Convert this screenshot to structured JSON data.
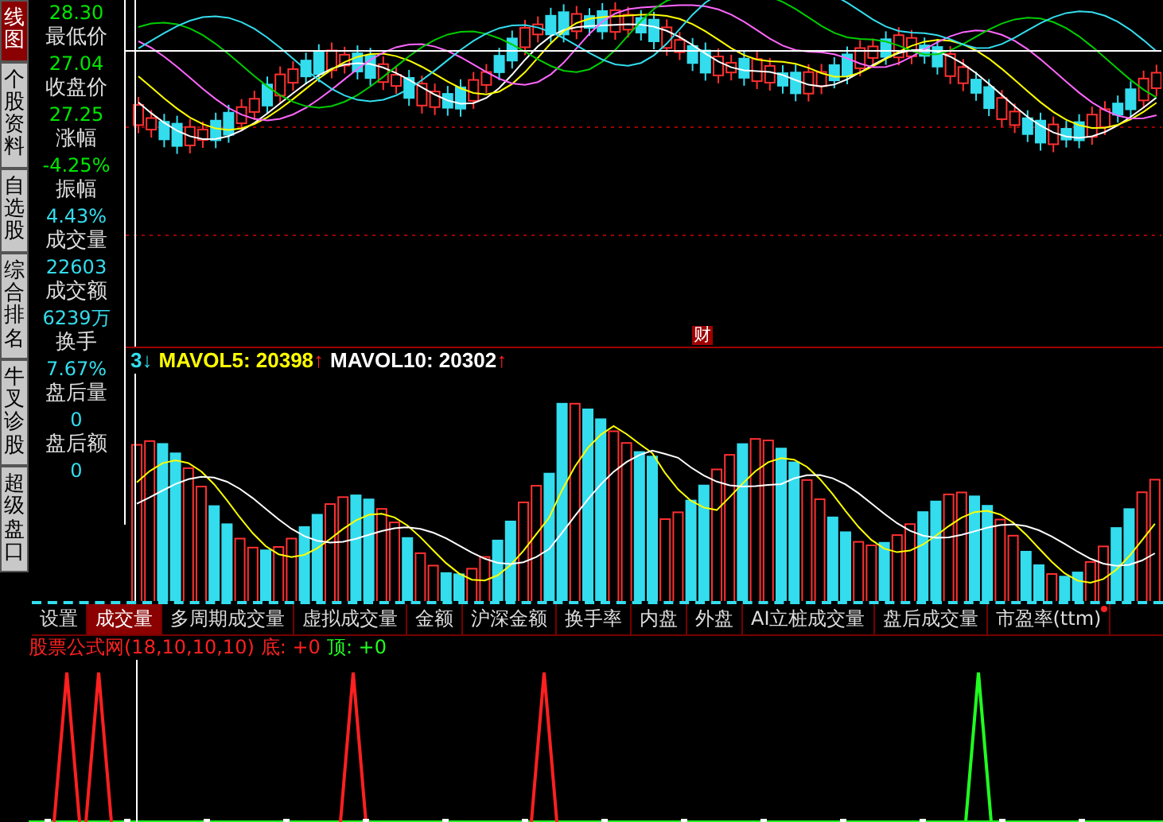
{
  "sidebar": [
    {
      "label": "线图",
      "selected": true
    },
    {
      "label": "个股资料",
      "selected": false
    },
    {
      "label": "自选股",
      "selected": false
    },
    {
      "label": "综合排名",
      "selected": false
    },
    {
      "label": "牛叉诊股",
      "selected": false
    },
    {
      "label": "超级盘口",
      "selected": false
    }
  ],
  "quote_panel": [
    {
      "value": "28.30",
      "color": "#00e600"
    },
    {
      "label": "最低价",
      "value": "27.04",
      "color": "#00e600"
    },
    {
      "label": "收盘价",
      "value": "27.25",
      "color": "#00e600"
    },
    {
      "label": "涨幅",
      "value": "-4.25%",
      "color": "#00e600"
    },
    {
      "label": "振幅",
      "value": "4.43%",
      "color": "#33ddee"
    },
    {
      "label": "成交量",
      "value": "22603",
      "color": "#33ddee"
    },
    {
      "label": "成交额",
      "value": "6239万",
      "color": "#33ddee"
    },
    {
      "label": "换手",
      "value": "7.67%",
      "color": "#33ddee"
    },
    {
      "label": "盘后量",
      "value": "0",
      "color": "#33ddee"
    },
    {
      "label": "盘后额",
      "value": "0",
      "color": "#33ddee"
    }
  ],
  "price_chart": {
    "marker": "财"
  },
  "volume_header": [
    {
      "text": "3",
      "color": "#33ddee",
      "arrow": {
        "text": "↓",
        "color": "#33ddee"
      }
    },
    {
      "text": "MAVOL5: 20398",
      "color": "#ffff00",
      "arrow": {
        "text": "↑",
        "color": "#ff2020"
      }
    },
    {
      "text": "MAVOL10: 20302",
      "color": "#ffffff",
      "arrow": {
        "text": "↑",
        "color": "#ff2020"
      }
    }
  ],
  "tabs": [
    {
      "label": "设置",
      "selected": false,
      "badge": false
    },
    {
      "label": "成交量",
      "selected": true,
      "badge": false
    },
    {
      "label": "多周期成交量",
      "selected": false,
      "badge": false
    },
    {
      "label": "虚拟成交量",
      "selected": false,
      "badge": false
    },
    {
      "label": "金额",
      "selected": false,
      "badge": false
    },
    {
      "label": "沪深金额",
      "selected": false,
      "badge": false
    },
    {
      "label": "换手率",
      "selected": false,
      "badge": false
    },
    {
      "label": "内盘",
      "selected": false,
      "badge": false
    },
    {
      "label": "外盘",
      "selected": false,
      "badge": false
    },
    {
      "label": "AI立桩成交量",
      "selected": false,
      "badge": false
    },
    {
      "label": "盘后成交量",
      "selected": false,
      "badge": false
    },
    {
      "label": "市盈率(ttm)",
      "selected": false,
      "badge": true
    }
  ],
  "indicator": {
    "name": "股票公式网(18,10,10,10)",
    "values": [
      {
        "text": "底: +0",
        "color": "#ff2020"
      },
      {
        "text": "顶: +0",
        "color": "#20ff20"
      }
    ]
  }
}
